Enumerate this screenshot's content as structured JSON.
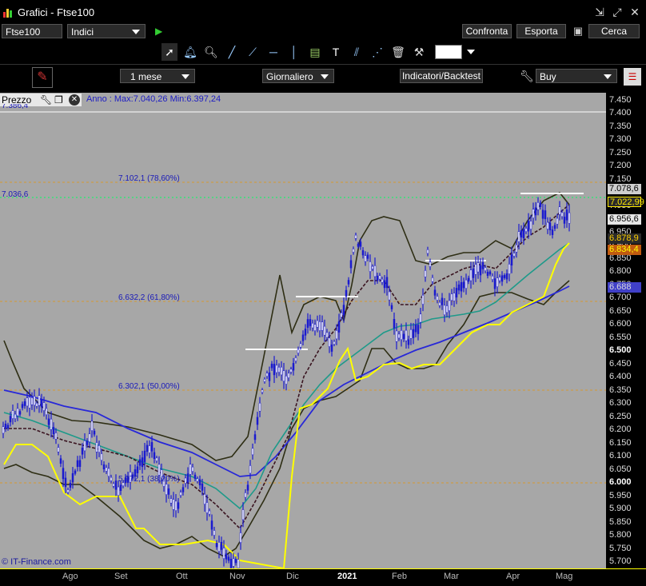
{
  "window": {
    "title": "Grafici  -  Ftse100"
  },
  "toolbar": {
    "symbol": "Ftse100",
    "category": "Indici",
    "confronta": "Confronta",
    "esporta": "Esporta",
    "cerca": "Cerca"
  },
  "toolbar2": {
    "period": "1 mese",
    "frequency": "Giornaliero",
    "indicators": "Indicatori/Backtest",
    "order": "Buy"
  },
  "chart_header": {
    "panel": "Prezzo",
    "info": "Anno : Max:7.040,26 Min:6.397,24",
    "cut_label": "7.386,4"
  },
  "y_axis": {
    "ticks": [
      "7.450",
      "7.400",
      "7.350",
      "7.300",
      "7.250",
      "7.200",
      "7.150",
      "7.100",
      "7.050",
      "6.950",
      "6.900",
      "6.850",
      "6.800",
      "6.750",
      "6.700",
      "6.650",
      "6.600",
      "6.550",
      "6.500",
      "6.450",
      "6.400",
      "6.350",
      "6.300",
      "6.250",
      "6.200",
      "6.150",
      "6.100",
      "6.050",
      "6.000",
      "5.950",
      "5.900",
      "5.850",
      "5.800",
      "5.750",
      "5.700"
    ],
    "bold_ticks": [
      "6.500",
      "6.000"
    ],
    "tags": {
      "t1": "7.078,6",
      "t2": "7.022,99",
      "t3": "6.956,6",
      "t4": "6.878,9",
      "t5": "6.834,4",
      "t6": "6.688"
    }
  },
  "left_label": "7.036,6",
  "fib_levels": [
    "7.102,1 (78,60%)",
    "6.632,2 (61,80%)",
    "6.302,1 (50,00%)",
    "5.972,1 (38,20%)"
  ],
  "x_axis": {
    "labels": [
      "Ago",
      "Set",
      "Ott",
      "Nov",
      "Dic",
      "2021",
      "Feb",
      "Mar",
      "Apr",
      "Mag"
    ]
  },
  "credit": "© IT-Finance.com",
  "colors": {
    "chart_bg": "#a7a7a7",
    "candles": "#1a1ad0",
    "bollinger": "#2e2e14",
    "ma_blue": "#2828d8",
    "ma_teal": "#1e9a8a",
    "ma_dash": "#3a1420",
    "ma_yellow": "#ffff00",
    "fib_line": "#d49a30",
    "green_line": "#00ff60"
  }
}
